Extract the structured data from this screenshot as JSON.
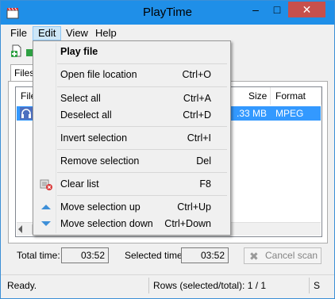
{
  "window": {
    "title": "PlayTime"
  },
  "menubar": {
    "items": [
      "File",
      "Edit",
      "View",
      "Help"
    ]
  },
  "tab": {
    "label": "Files"
  },
  "list": {
    "columns": [
      "File",
      "Size",
      "Format"
    ],
    "rows": [
      {
        "size": ".33 MB",
        "format": "MPEG Audio"
      }
    ]
  },
  "fields": {
    "total_time_label": "Total time:",
    "total_time_value": "03:52",
    "selected_time_label": "Selected time:",
    "selected_time_value": "03:52",
    "cancel_scan_label": "Cancel scan"
  },
  "status": {
    "ready": "Ready.",
    "rows": "Rows (selected/total): 1 / 1",
    "extra": "S"
  },
  "edit_menu": {
    "play_file": "Play file",
    "open_file_location": "Open file location",
    "open_file_location_shortcut": "Ctrl+O",
    "select_all": "Select all",
    "select_all_shortcut": "Ctrl+A",
    "deselect_all": "Deselect all",
    "deselect_all_shortcut": "Ctrl+D",
    "invert_selection": "Invert selection",
    "invert_selection_shortcut": "Ctrl+I",
    "remove_selection": "Remove selection",
    "remove_selection_shortcut": "Del",
    "clear_list": "Clear list",
    "clear_list_shortcut": "F8",
    "move_up": "Move selection up",
    "move_up_shortcut": "Ctrl+Up",
    "move_down": "Move selection down",
    "move_down_shortcut": "Ctrl+Down"
  },
  "colors": {
    "titlebar": "#1f8fe8",
    "selection": "#3399ff",
    "close": "#c7504c"
  }
}
